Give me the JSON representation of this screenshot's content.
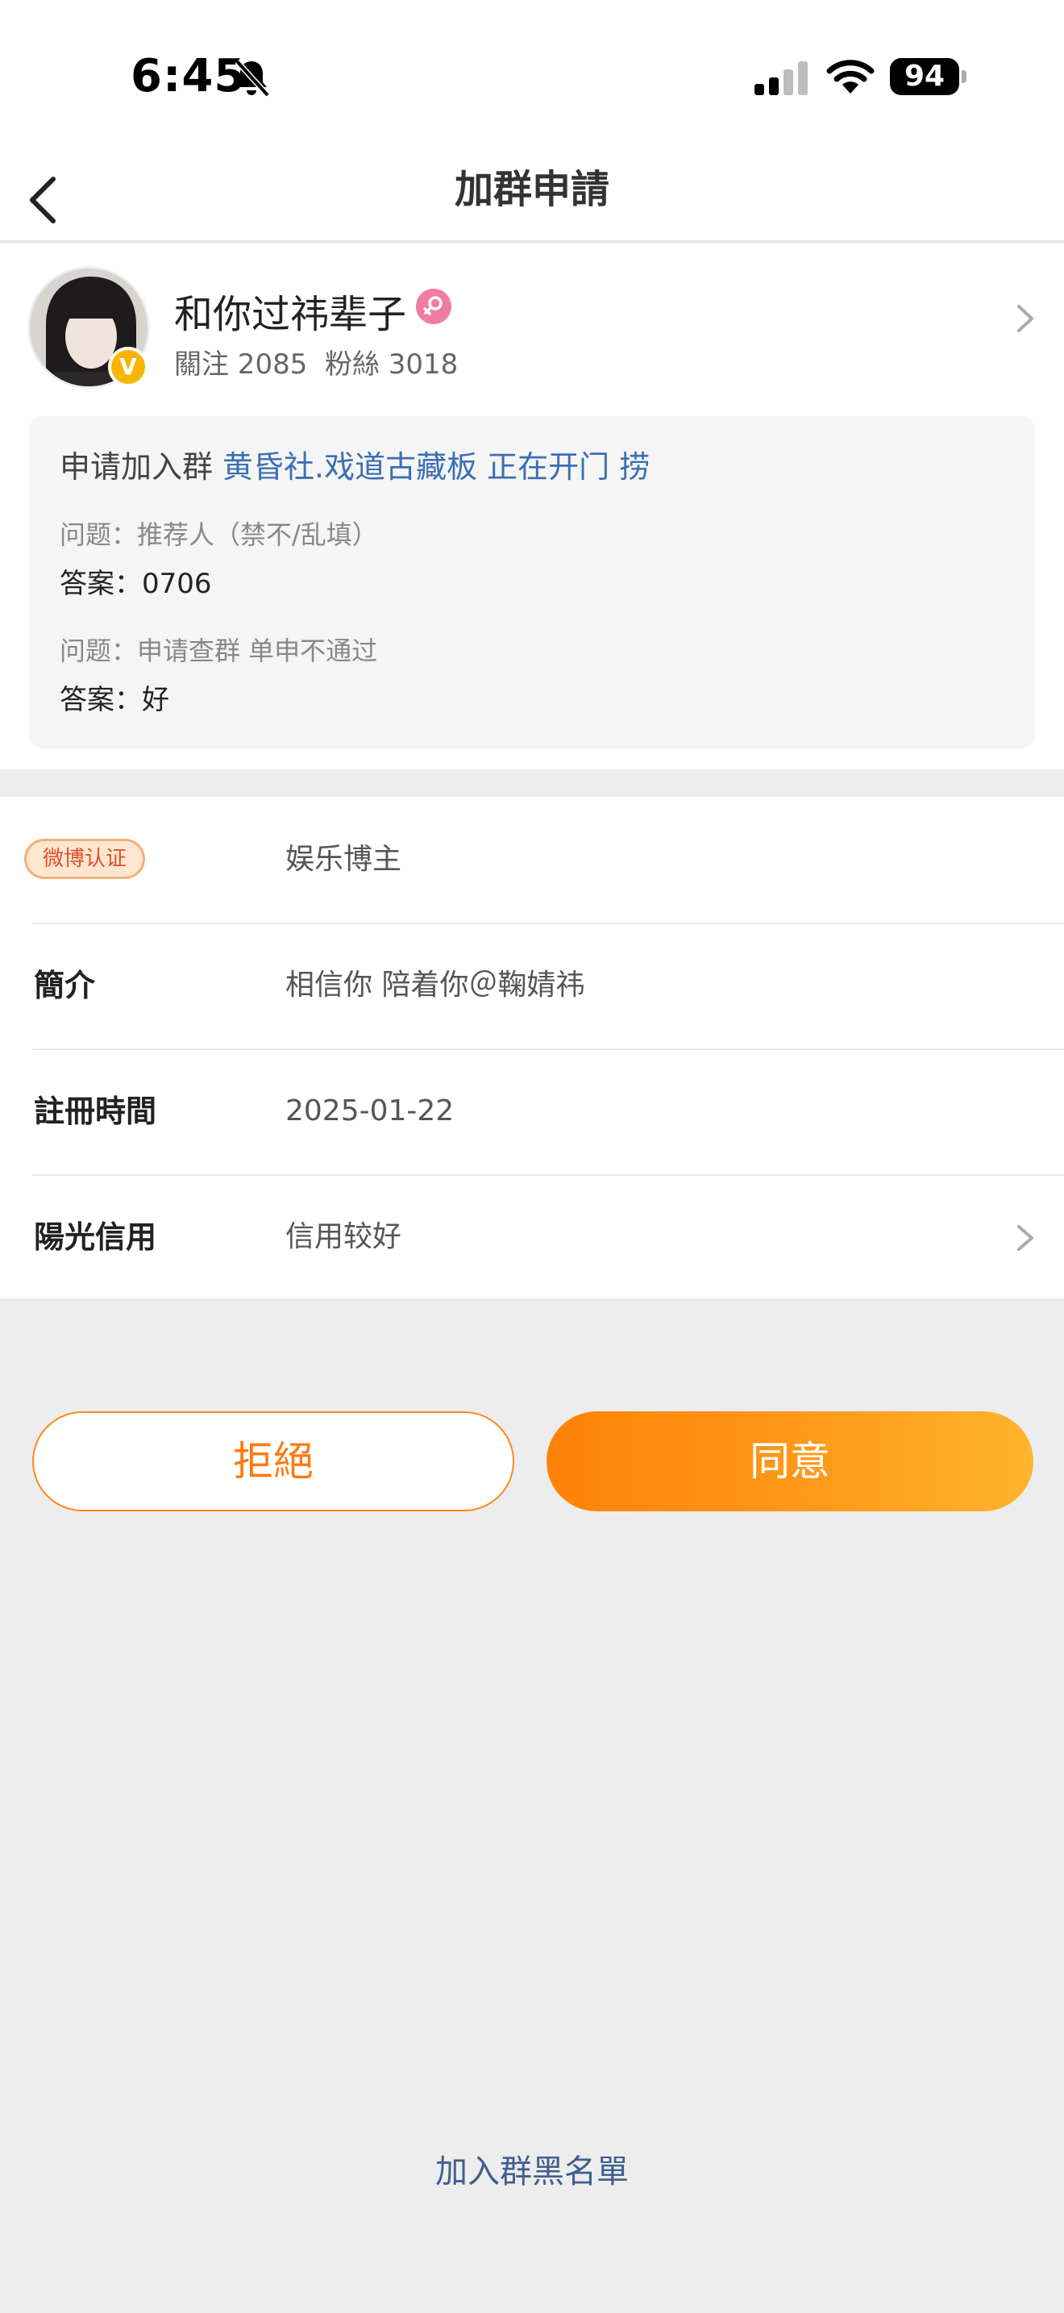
{
  "status_bar": {
    "time": "6:45",
    "battery": "94"
  },
  "nav": {
    "title": "加群申請"
  },
  "applicant": {
    "name": "和你过祎辈子",
    "stats": "關注 2085  粉絲 3018",
    "apply_prefix": "申请加入群",
    "group_name": "黄昏社.戏道古藏板 正在开门 捞",
    "questions": [
      {
        "question": "问题：推荐人（禁不/乱填）",
        "answer": "答案：0706"
      },
      {
        "question": "问题：申请查群 单申不通过",
        "answer": "答案：好"
      }
    ]
  },
  "info": {
    "weibo_badge": "微博认证",
    "weibo_value": "娱乐博主",
    "intro_label": "簡介",
    "intro_value": "相信你 陪着你＠鞠婧祎",
    "register_label": "註冊時間",
    "register_value": "2025-01-22",
    "credit_label": "陽光信用",
    "credit_value": "信用较好"
  },
  "actions": {
    "reject": "拒絕",
    "approve": "同意",
    "blacklist": "加入群黑名單"
  },
  "colors": {
    "accent_orange": "#ff8208",
    "link_blue": "#3b6fb4",
    "badge_yellow": "#f7b500",
    "female_pink": "#f07ca6"
  }
}
